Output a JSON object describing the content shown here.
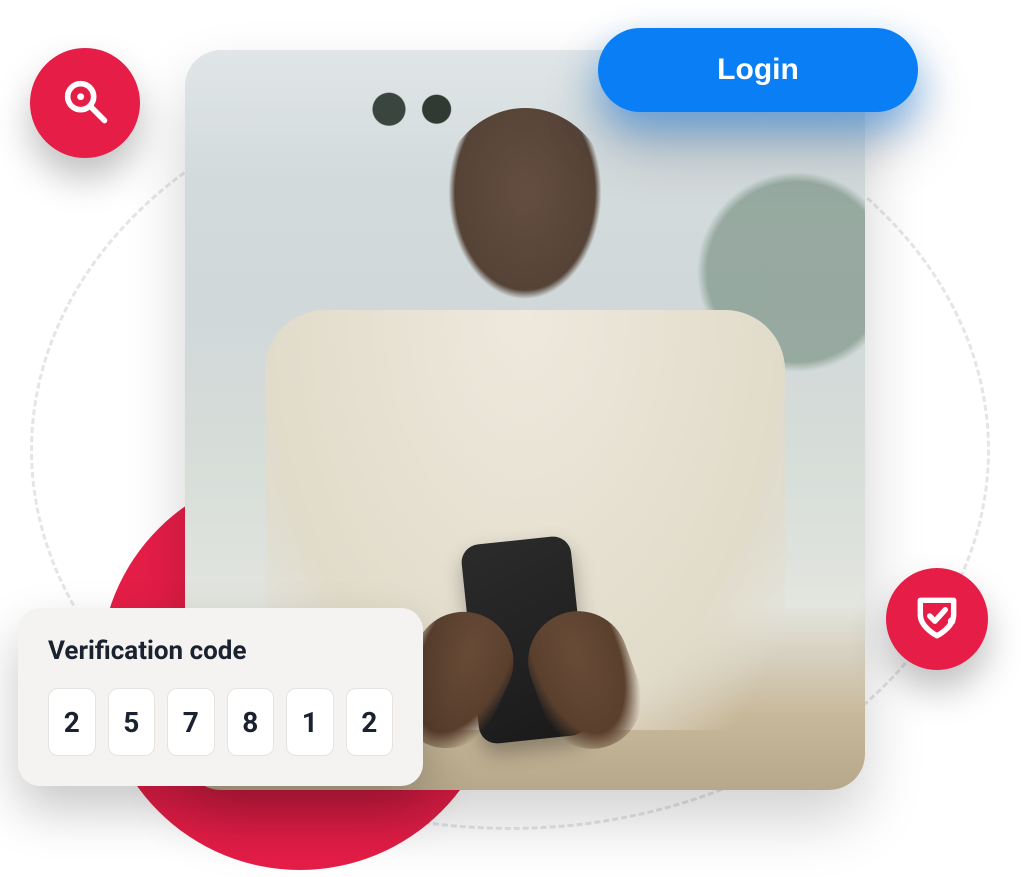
{
  "login": {
    "label": "Login"
  },
  "verification": {
    "title": "Verification code",
    "digits": [
      "2",
      "5",
      "7",
      "8",
      "1",
      "2"
    ]
  },
  "icons": {
    "search": "search-icon",
    "check": "check-shield-icon"
  },
  "colors": {
    "accent_red": "#E51D47",
    "accent_blue": "#0A7FF5",
    "card_bg": "#F5F3F2"
  },
  "image_alt": "Smiling man wearing glasses looking at his phone"
}
